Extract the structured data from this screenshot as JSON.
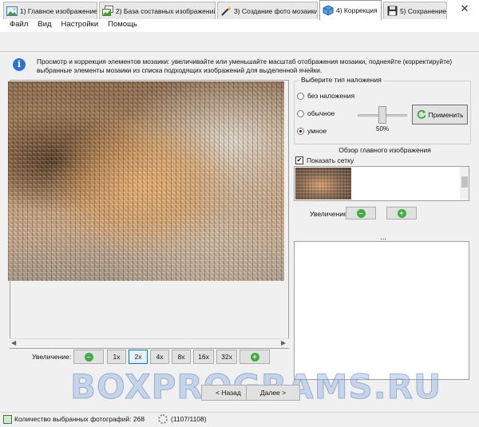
{
  "window": {
    "minimize": "–",
    "maximize": "☐",
    "close": "✕"
  },
  "menu": [
    "Файл",
    "Вид",
    "Настройки",
    "Помощь"
  ],
  "tabs": [
    {
      "label": "1) Главное изображение",
      "icon": "image-icon"
    },
    {
      "label": "2) База составных изображений",
      "icon": "image-stack-icon"
    },
    {
      "label": "3) Создание фото мозаики",
      "icon": "magic-wand-icon"
    },
    {
      "label": "4) Коррекция",
      "icon": "cube-icon",
      "active": true
    },
    {
      "label": "5) Сохранение",
      "icon": "floppy-disk-icon"
    }
  ],
  "info": {
    "text": "Просмотр и коррекция элементов мозаики: увеличивайте или уменьшайте масштаб отображения мозаики, поднеяйте (корректируйте) выбранные элементы мозаики из списка подходящих изображений для выделенной ячейки."
  },
  "zoom_bar": {
    "label": "Увеличение:",
    "minus": "–",
    "levels": [
      "1x",
      "2x",
      "4x",
      "8x",
      "16x",
      "32x"
    ],
    "selected": "2x",
    "plus": "+"
  },
  "overlay": {
    "title": "Выберите тип наложения",
    "options": [
      "без наложения",
      "обычное",
      "умное"
    ],
    "selected": "умное",
    "slider_value_percent": 50,
    "slider_label": "50%",
    "apply_label": "Применить"
  },
  "overview": {
    "title": "Обзор главного изображения",
    "show_grid_label": "Показать сетку",
    "show_grid_checked": true,
    "zoom_label": "Увеличение",
    "minus": "–",
    "plus": "+",
    "ellipsis": "..."
  },
  "navigation": {
    "back": "< Назад",
    "next": "Далее >"
  },
  "watermark": "BOXPROGRAMS.RU",
  "status": {
    "selected_count": "Количество выбранных фотографий: 268",
    "progress": "(1107/1108)"
  },
  "colors": {
    "accent": "#0078d7",
    "apply_icon": "#3fae3f",
    "info_icon": "#2f73d1"
  }
}
